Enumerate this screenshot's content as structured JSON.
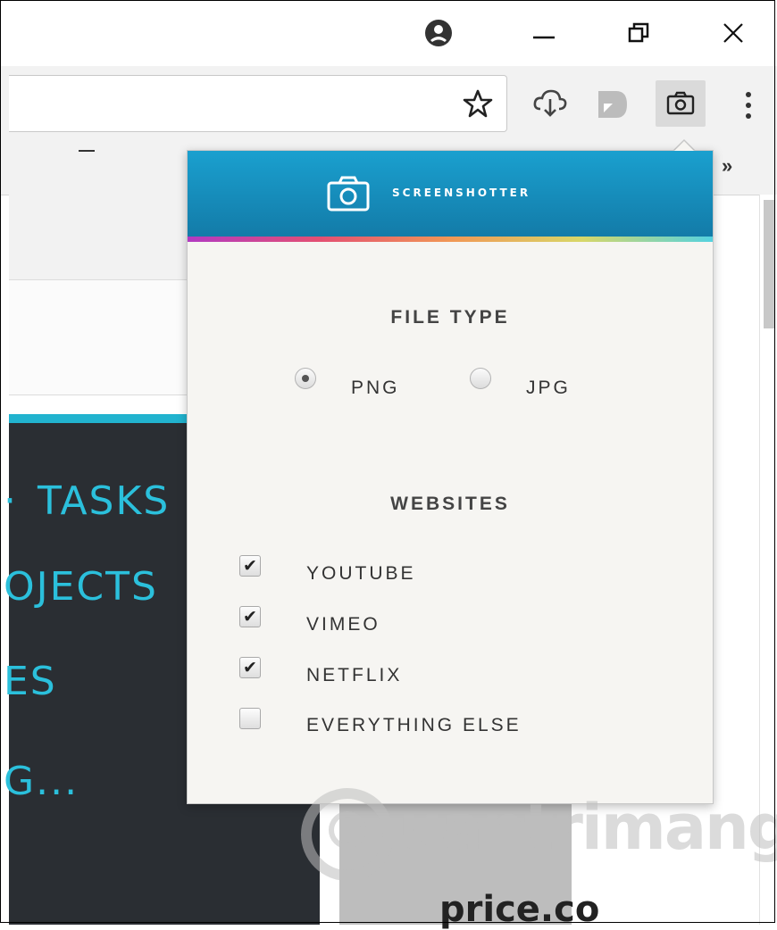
{
  "popup": {
    "title": "SCREENSHOTTER",
    "file_type": {
      "heading": "FILE TYPE",
      "options": [
        {
          "label": "PNG",
          "selected": true
        },
        {
          "label": "JPG",
          "selected": false
        }
      ]
    },
    "websites": {
      "heading": "WEBSITES",
      "items": [
        {
          "label": "YOUTUBE",
          "checked": true
        },
        {
          "label": "VIMEO",
          "checked": true
        },
        {
          "label": "NETFLIX",
          "checked": true
        },
        {
          "label": "EVERYTHING ELSE",
          "checked": false
        }
      ]
    }
  },
  "toolbar": {
    "overflow_label": "»"
  },
  "page": {
    "nav_items": [
      "TASKS",
      "OJECTS",
      "ES",
      "G..."
    ],
    "card_text": "price.co"
  },
  "watermark": {
    "text": "uantrimang"
  },
  "colors": {
    "header_blue": "#1aa0cf",
    "accent_cyan": "#2bc0dc",
    "dark_panel": "#2a2e33"
  }
}
